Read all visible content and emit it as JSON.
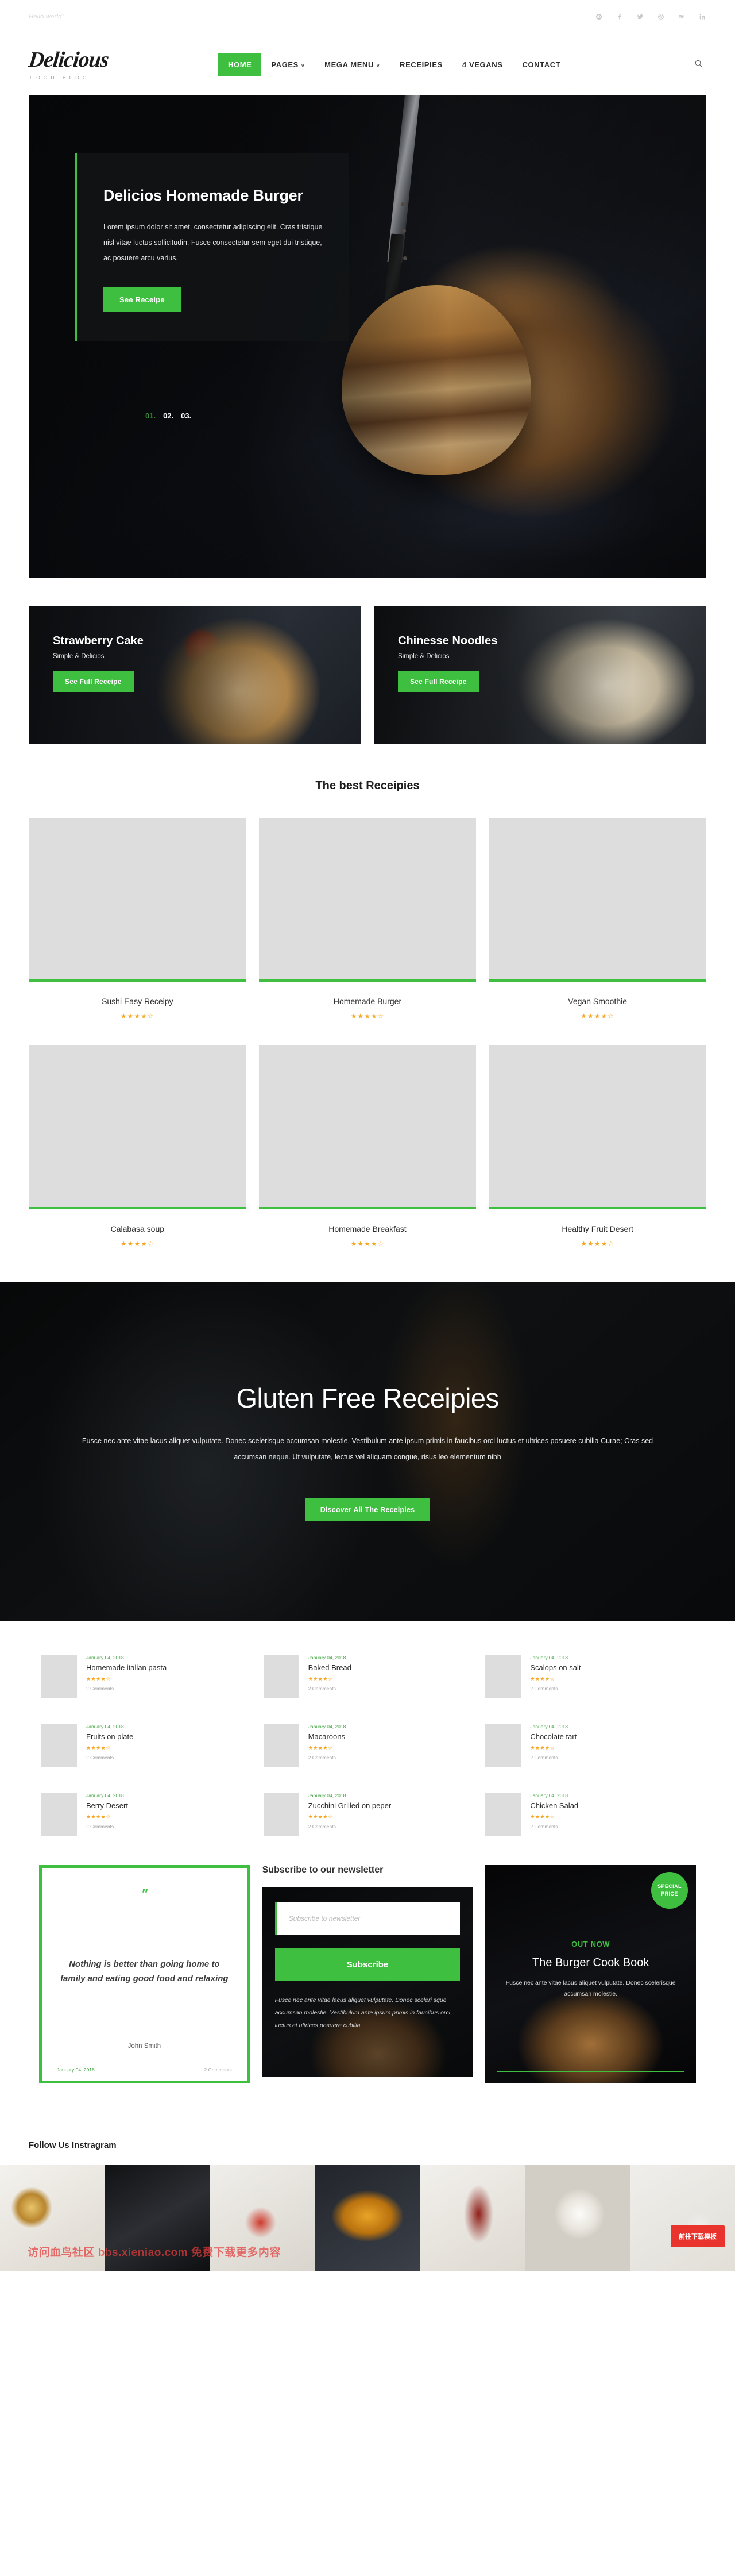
{
  "topbar": {
    "greeting": "Hello world!",
    "socials": [
      {
        "name": "pinterest-icon",
        "glyph": "P"
      },
      {
        "name": "facebook-icon",
        "glyph": "f"
      },
      {
        "name": "twitter-icon",
        "glyph": "t"
      },
      {
        "name": "dribbble-icon",
        "glyph": "d"
      },
      {
        "name": "behance-icon",
        "glyph": "Bē"
      },
      {
        "name": "linkedin-icon",
        "glyph": "in"
      }
    ]
  },
  "brand": {
    "name": "Delicious",
    "tagline": "FOOD BLOG"
  },
  "nav": {
    "items": [
      {
        "label": "HOME",
        "active": true,
        "caret": false
      },
      {
        "label": "PAGES",
        "active": false,
        "caret": true
      },
      {
        "label": "MEGA MENU",
        "active": false,
        "caret": true
      },
      {
        "label": "RECEIPIES",
        "active": false,
        "caret": false
      },
      {
        "label": "4 VEGANS",
        "active": false,
        "caret": false
      },
      {
        "label": "CONTACT",
        "active": false,
        "caret": false
      }
    ],
    "caret_glyph": "∨",
    "search_label": "search-icon"
  },
  "hero": {
    "title": "Delicios Homemade Burger",
    "text": "Lorem ipsum dolor sit amet, consectetur adipiscing elit. Cras tristique nisl vitae luctus sollicitudin. Fusce consectetur sem eget dui tristique, ac posuere arcu varius.",
    "cta": "See Receipe",
    "slides": [
      "01.",
      "02.",
      "03."
    ],
    "active_slide": 0
  },
  "promos": [
    {
      "title": "Strawberry Cake",
      "subtitle": "Simple & Delicios",
      "cta": "See Full Receipe"
    },
    {
      "title": "Chinesse Noodles",
      "subtitle": "Simple & Delicios",
      "cta": "See Full Receipe"
    }
  ],
  "best": {
    "title": "The best Receipies",
    "items": [
      {
        "name": "Sushi Easy Receipy",
        "rating": 4,
        "max": 5
      },
      {
        "name": "Homemade Burger",
        "rating": 4,
        "max": 5
      },
      {
        "name": "Vegan Smoothie",
        "rating": 4,
        "max": 5
      },
      {
        "name": "Calabasa soup",
        "rating": 4,
        "max": 5
      },
      {
        "name": "Homemade Breakfast",
        "rating": 4,
        "max": 5
      },
      {
        "name": "Healthy Fruit Desert",
        "rating": 4,
        "max": 5
      }
    ]
  },
  "gluten": {
    "title": "Gluten Free Receipies",
    "text": "Fusce nec ante vitae lacus aliquet vulputate. Donec scelerisque accumsan molestie. Vestibulum ante ipsum primis in faucibus orci luctus et ultrices posuere cubilia Curae; Cras sed accumsan neque. Ut vulputate, lectus vel aliquam congue, risus leo elementum nibh",
    "cta": "Discover All The Receipies"
  },
  "posts": [
    {
      "date": "January 04, 2018",
      "title": "Homemade italian pasta",
      "rating": 4,
      "comments": "2 Comments"
    },
    {
      "date": "January 04, 2018",
      "title": "Baked Bread",
      "rating": 4,
      "comments": "2 Comments"
    },
    {
      "date": "January 04, 2018",
      "title": "Scalops on salt",
      "rating": 4,
      "comments": "2 Comments"
    },
    {
      "date": "January 04, 2018",
      "title": "Fruits on plate",
      "rating": 4,
      "comments": "2 Comments"
    },
    {
      "date": "January 04, 2018",
      "title": "Macaroons",
      "rating": 4,
      "comments": "2 Comments"
    },
    {
      "date": "January 04, 2018",
      "title": "Chocolate tart",
      "rating": 4,
      "comments": "2 Comments"
    },
    {
      "date": "January 04, 2018",
      "title": "Berry Desert",
      "rating": 4,
      "comments": "2 Comments"
    },
    {
      "date": "January 04, 2018",
      "title": "Zucchini Grilled on peper",
      "rating": 4,
      "comments": "2 Comments"
    },
    {
      "date": "January 04, 2018",
      "title": "Chicken Salad",
      "rating": 4,
      "comments": "2 Comments"
    }
  ],
  "quote": {
    "mark": "\"",
    "text": "Nothing is better than going home to family and eating good food and relaxing",
    "author": "John Smith",
    "date": "January 04, 2018",
    "comments": "2 Comments"
  },
  "newsletter": {
    "title": "Subscribe to our newsletter",
    "placeholder": "Subscribe to newsletter",
    "value": "",
    "button": "Subscribe",
    "note": "Fusce nec ante vitae lacus aliquet vulputate. Donec sceleri sque accumsan molestie. Vestibulum ante ipsum primis in faucibus orci luctus et ultrices posuere cubilia."
  },
  "book": {
    "badge_line1": "SPECIAL",
    "badge_line2": "PRICE",
    "kicker": "OUT NOW",
    "title": "The Burger Cook Book",
    "text": "Fusce nec ante vitae lacus aliquet vulputate. Donec scelerisque accumsan molestie."
  },
  "instagram": {
    "title": "Follow Us Instragram"
  },
  "overlay": {
    "watermark": "访问血鸟社区 bbs.xieniao.com 免费下载更多内容",
    "download_badge": "前往下载模板"
  },
  "colors": {
    "accent_green": "#3fbf3f",
    "star_gold": "#f5a623",
    "date_green": "#3fa53f",
    "red_badge": "#e8342c"
  }
}
